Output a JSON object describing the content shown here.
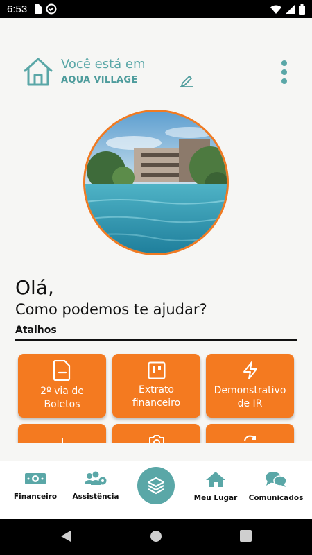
{
  "status_bar": {
    "time": "6:53"
  },
  "header": {
    "location_prefix": "Você está em",
    "location_name": "AQUA VILLAGE"
  },
  "greeting": {
    "hello": "Olá,",
    "question": "Como podemos te ajudar?"
  },
  "shortcuts": {
    "label": "Atalhos",
    "items": [
      {
        "label": "2º via de Boletos",
        "icon": "document-minus-icon"
      },
      {
        "label": "Extrato financeiro",
        "icon": "statement-icon"
      },
      {
        "label": "Demonstrativo de IR",
        "icon": "lightning-icon"
      },
      {
        "label": "",
        "icon": "add-icon"
      },
      {
        "label": "",
        "icon": "camera-icon"
      },
      {
        "label": "",
        "icon": "refresh-icon"
      }
    ]
  },
  "bottom_nav": {
    "items": [
      {
        "label": "Financeiro",
        "icon": "money-icon"
      },
      {
        "label": "Assistência",
        "icon": "users-gear-icon"
      },
      {
        "label": "",
        "icon": "layers-icon"
      },
      {
        "label": "Meu Lugar",
        "icon": "house-icon"
      },
      {
        "label": "Comunicados",
        "icon": "chat-icon"
      }
    ]
  },
  "colors": {
    "accent_orange": "#f47a20",
    "accent_teal": "#5aa7a7",
    "background": "#f6f6f4"
  }
}
